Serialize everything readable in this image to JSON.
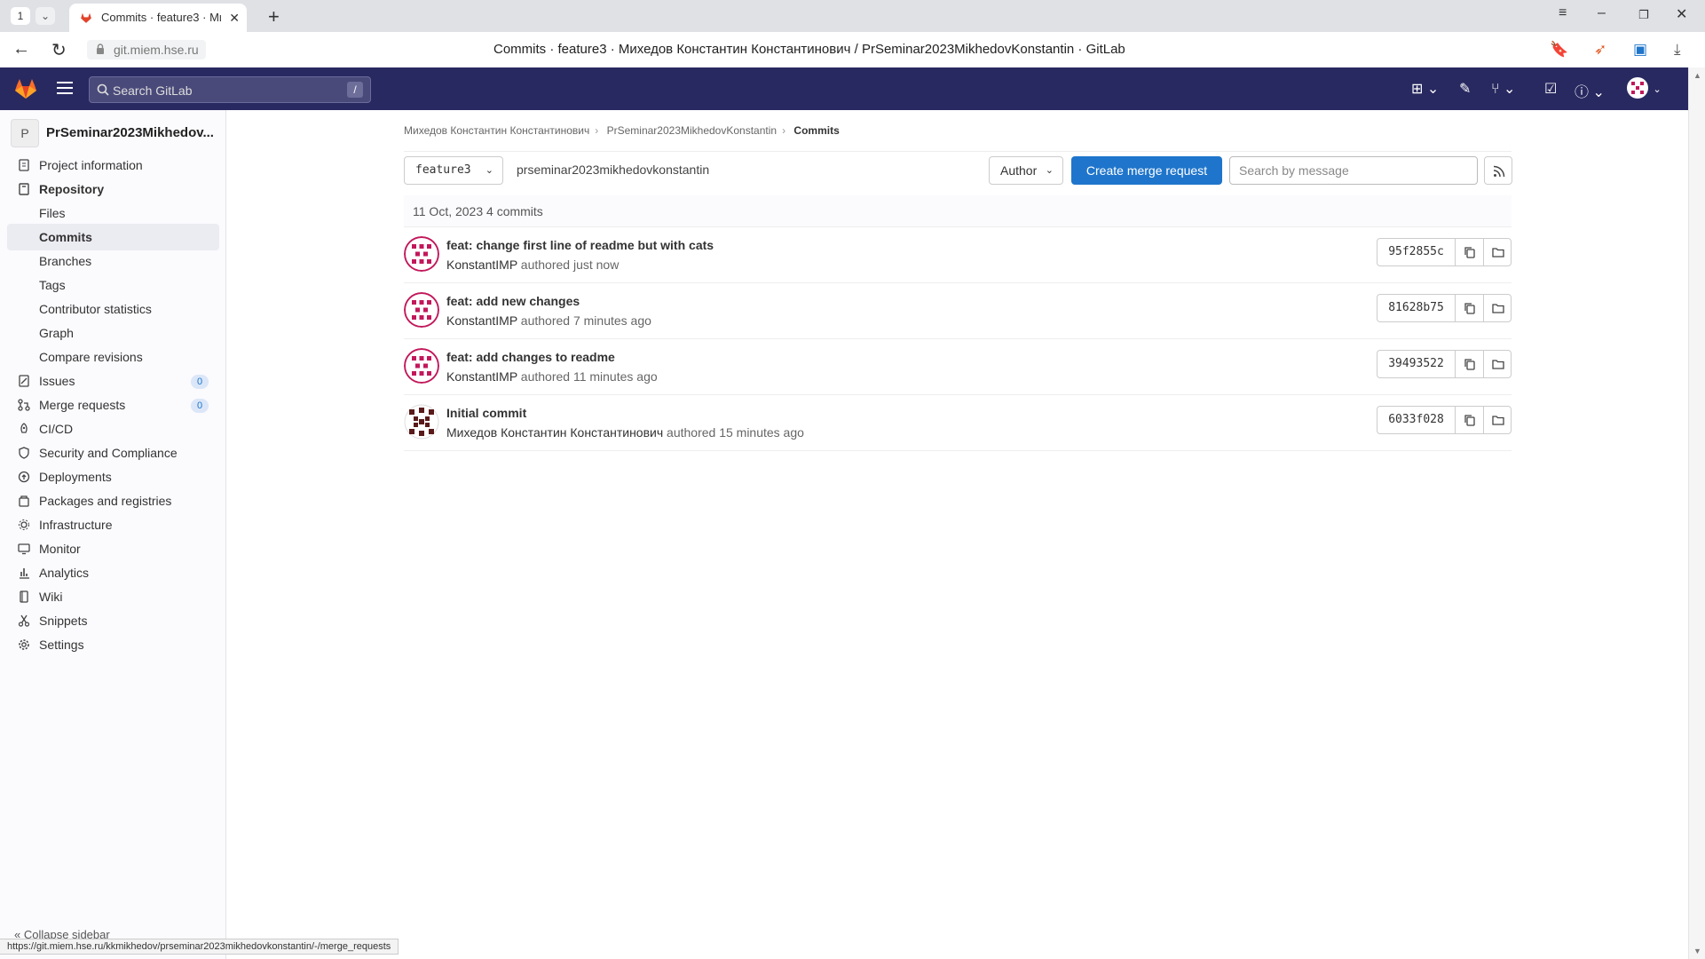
{
  "browser": {
    "tab_count": "1",
    "tab_title": "Commits · feature3 · Михедов Константин Константинович / PrSeminar2023MikhedovKonstantin · GitLab",
    "url": "git.miem.hse.ru",
    "page_title": "Commits · feature3 · Михедов Константин Константинович / PrSeminar2023MikhedovKonstantin · GitLab",
    "status_url": "https://git.miem.hse.ru/kkmikhedov/prseminar2023mikhedovkonstantin/-/merge_requests"
  },
  "topnav": {
    "search_placeholder": "Search GitLab",
    "search_shortcut": "/"
  },
  "sidebar": {
    "project_avatar": "P",
    "project_name": "PrSeminar2023Mikhedov...",
    "items": [
      {
        "label": "Project information",
        "icon": "info-icon"
      },
      {
        "label": "Repository",
        "icon": "book-icon"
      },
      {
        "label": "Issues",
        "icon": "issues-icon",
        "count": "0"
      },
      {
        "label": "Merge requests",
        "icon": "merge-request-icon",
        "count": "0"
      },
      {
        "label": "CI/CD",
        "icon": "rocket-icon"
      },
      {
        "label": "Security and Compliance",
        "icon": "shield-icon"
      },
      {
        "label": "Deployments",
        "icon": "deployments-icon"
      },
      {
        "label": "Packages and registries",
        "icon": "package-icon"
      },
      {
        "label": "Infrastructure",
        "icon": "cloud-icon"
      },
      {
        "label": "Monitor",
        "icon": "monitor-icon"
      },
      {
        "label": "Analytics",
        "icon": "chart-icon"
      },
      {
        "label": "Wiki",
        "icon": "wiki-icon"
      },
      {
        "label": "Snippets",
        "icon": "snippet-icon"
      },
      {
        "label": "Settings",
        "icon": "gear-icon"
      }
    ],
    "repo_sub": [
      "Files",
      "Commits",
      "Branches",
      "Tags",
      "Contributor statistics",
      "Graph",
      "Compare revisions"
    ],
    "collapse_label": "Collapse sidebar"
  },
  "breadcrumb": {
    "owner": "Михедов Константин Константинович",
    "project": "PrSeminar2023MikhedovKonstantin",
    "current": "Commits"
  },
  "toolbar": {
    "branch": "feature3",
    "path": "prseminar2023mikhedovkonstantin",
    "author_label": "Author",
    "create_mr_label": "Create merge request",
    "search_placeholder": "Search by message"
  },
  "day_header": "11 Oct, 2023 4 commits",
  "commits": [
    {
      "title": "feat: change first line of readme but with cats",
      "author": "KonstantIMP",
      "time": "authored just now",
      "sha": "95f2855c"
    },
    {
      "title": "feat: add new changes",
      "author": "KonstantIMP",
      "time": "authored 7 minutes ago",
      "sha": "81628b75"
    },
    {
      "title": "feat: add changes to readme",
      "author": "KonstantIMP",
      "time": "authored 11 minutes ago",
      "sha": "39493522"
    },
    {
      "title": "Initial commit",
      "author": "Михедов Константин Константинович",
      "time": "authored 15 minutes ago",
      "sha": "6033f028"
    }
  ],
  "colors": {
    "nav_bg": "#292961",
    "primary": "#1f75cb",
    "avatar_pink": "#c2185b",
    "avatar_dark": "#5a1a1a"
  }
}
